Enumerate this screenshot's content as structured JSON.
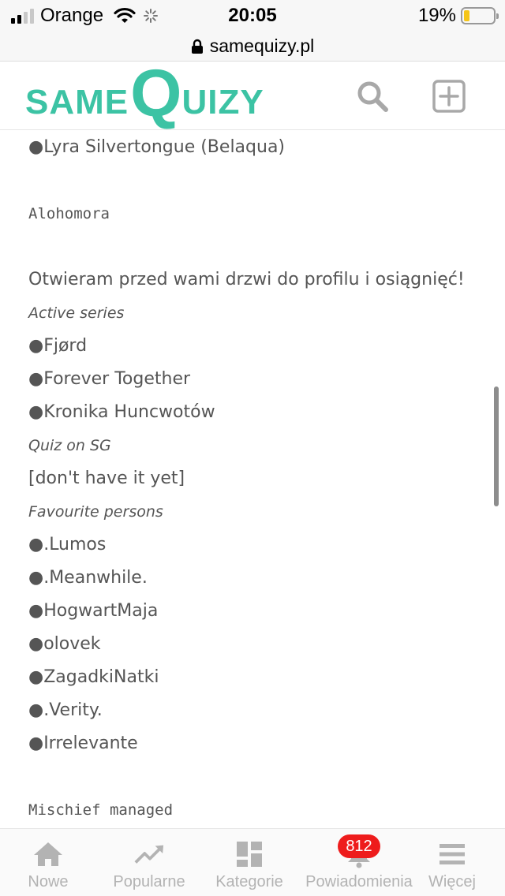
{
  "status_bar": {
    "carrier": "Orange",
    "time": "20:05",
    "battery": "19%",
    "battery_level": 0.19,
    "signal_bars": 2
  },
  "browser": {
    "url": "samequizy.pl"
  },
  "header": {
    "logo_same": "SAME",
    "logo_q": "Q",
    "logo_uizy": "UIZY",
    "search_icon": "search-icon",
    "add_icon": "add-square-icon",
    "brand_color": "#3cc3a4"
  },
  "content": {
    "lines": [
      "●Lyra Silvertongue (Belaqua)",
      "Alohomora",
      "Otwieram przed wami drzwi do profilu i osiągnięć!",
      "Active series",
      "●Fjørd",
      "●Forever Together",
      "●Kronika Huncwotów",
      "Quiz on SG",
      "[don't have it yet]",
      "Favourite persons",
      "●.Lumos",
      "●.Meanwhile.",
      "●HogwartMaja",
      "●olovek",
      "●ZagadkiNatki",
      "●.Verity.",
      "●Irrelevante",
      "Mischief managed"
    ]
  },
  "bottom_nav": {
    "items": [
      {
        "label": "Nowe",
        "icon": "home-icon"
      },
      {
        "label": "Popularne",
        "icon": "trending-icon"
      },
      {
        "label": "Kategorie",
        "icon": "grid-icon"
      },
      {
        "label": "Powiadomienia",
        "icon": "bell-icon",
        "badge": "812"
      },
      {
        "label": "Więcej",
        "icon": "menu-icon"
      }
    ],
    "badge_color": "#ee1c1c"
  }
}
